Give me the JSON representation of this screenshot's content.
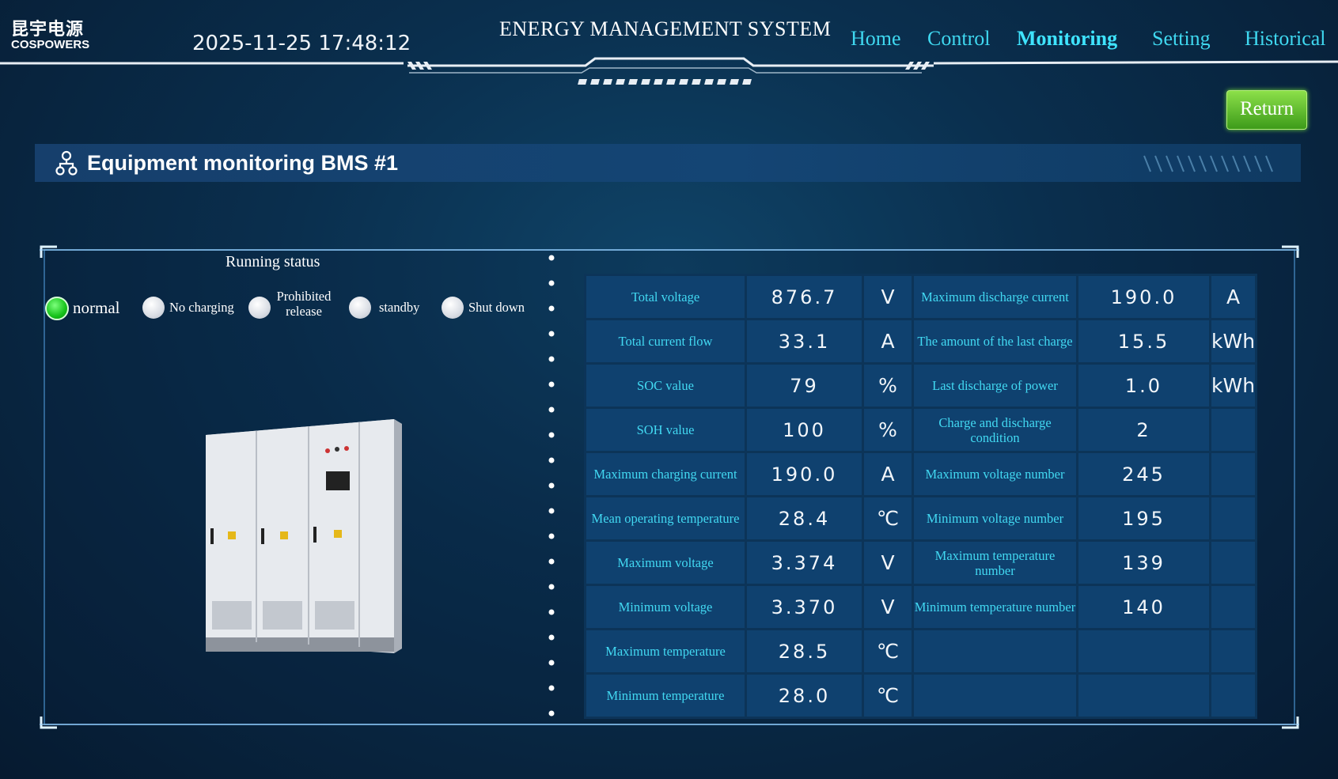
{
  "header": {
    "logo_cn": "昆宇电源",
    "logo_en": "COSPOWERS",
    "datetime": "2025-11-25 17:48:12",
    "system_title": "ENERGY MANAGEMENT SYSTEM",
    "nav": [
      "Home",
      "Control",
      "Monitoring",
      "Setting",
      "Historical"
    ],
    "active_nav": "Monitoring",
    "return_label": "Return"
  },
  "section": {
    "title": "Equipment monitoring BMS #1",
    "icon": "network-icon"
  },
  "running_status": {
    "title": "Running status",
    "states": [
      "normal",
      "No charging",
      "Prohibited release",
      "standby",
      "Shut down"
    ],
    "active": "normal"
  },
  "metrics_left": [
    {
      "label": "Total voltage",
      "value": "876.7",
      "unit": "V"
    },
    {
      "label": "Total current flow",
      "value": "33.1",
      "unit": "A"
    },
    {
      "label": "SOC value",
      "value": "79",
      "unit": "%"
    },
    {
      "label": "SOH value",
      "value": "100",
      "unit": "%"
    },
    {
      "label": "Maximum charging current",
      "value": "190.0",
      "unit": "A"
    },
    {
      "label": "Mean operating temperature",
      "value": "28.4",
      "unit": "℃"
    },
    {
      "label": "Maximum voltage",
      "value": "3.374",
      "unit": "V"
    },
    {
      "label": "Minimum voltage",
      "value": "3.370",
      "unit": "V"
    },
    {
      "label": "Maximum temperature",
      "value": "28.5",
      "unit": "℃"
    },
    {
      "label": "Minimum temperature",
      "value": "28.0",
      "unit": "℃"
    }
  ],
  "metrics_right": [
    {
      "label": "Maximum discharge current",
      "value": "190.0",
      "unit": "A"
    },
    {
      "label": "The amount of the last charge",
      "value": "15.5",
      "unit": "kWh"
    },
    {
      "label": "Last discharge of power",
      "value": "1.0",
      "unit": "kWh"
    },
    {
      "label": "Charge and discharge condition",
      "value": "2",
      "unit": ""
    },
    {
      "label": "Maximum voltage number",
      "value": "245",
      "unit": ""
    },
    {
      "label": "Minimum voltage number",
      "value": "195",
      "unit": ""
    },
    {
      "label": "Maximum temperature number",
      "value": "139",
      "unit": ""
    },
    {
      "label": "Minimum temperature number",
      "value": "140",
      "unit": ""
    },
    {
      "label": "",
      "value": "",
      "unit": ""
    },
    {
      "label": "",
      "value": "",
      "unit": ""
    }
  ],
  "colors": {
    "accent": "#3fd8f0",
    "return_button": "#5cc22c",
    "status_on": "#16c21a"
  }
}
